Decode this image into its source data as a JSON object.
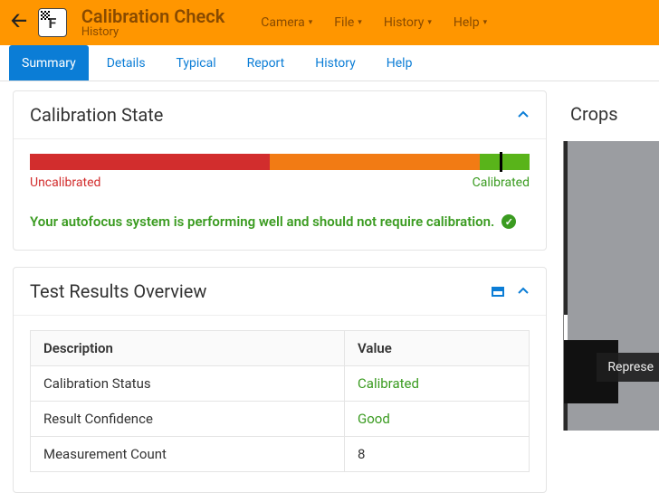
{
  "header": {
    "title": "Calibration Check",
    "subtitle": "History",
    "menu": [
      "Camera",
      "File",
      "History",
      "Help"
    ]
  },
  "tabs": [
    "Summary",
    "Details",
    "Typical",
    "Report",
    "History",
    "Help"
  ],
  "active_tab_index": 0,
  "calibration_card": {
    "title": "Calibration State",
    "left_label": "Uncalibrated",
    "right_label": "Calibrated",
    "segments": {
      "red_pct": 48,
      "orange_pct": 42,
      "green_pct": 10
    },
    "marker_pct": 94,
    "status_text": "Your autofocus system is performing well and should not require calibration."
  },
  "results_card": {
    "title": "Test Results Overview",
    "columns": [
      "Description",
      "Value"
    ],
    "rows": [
      {
        "desc": "Calibration Status",
        "value": "Calibrated",
        "green": true
      },
      {
        "desc": "Result Confidence",
        "value": "Good",
        "green": true
      },
      {
        "desc": "Measurement Count",
        "value": "8",
        "green": false
      }
    ]
  },
  "crops": {
    "title": "Crops",
    "overlay_label": "Represe"
  }
}
